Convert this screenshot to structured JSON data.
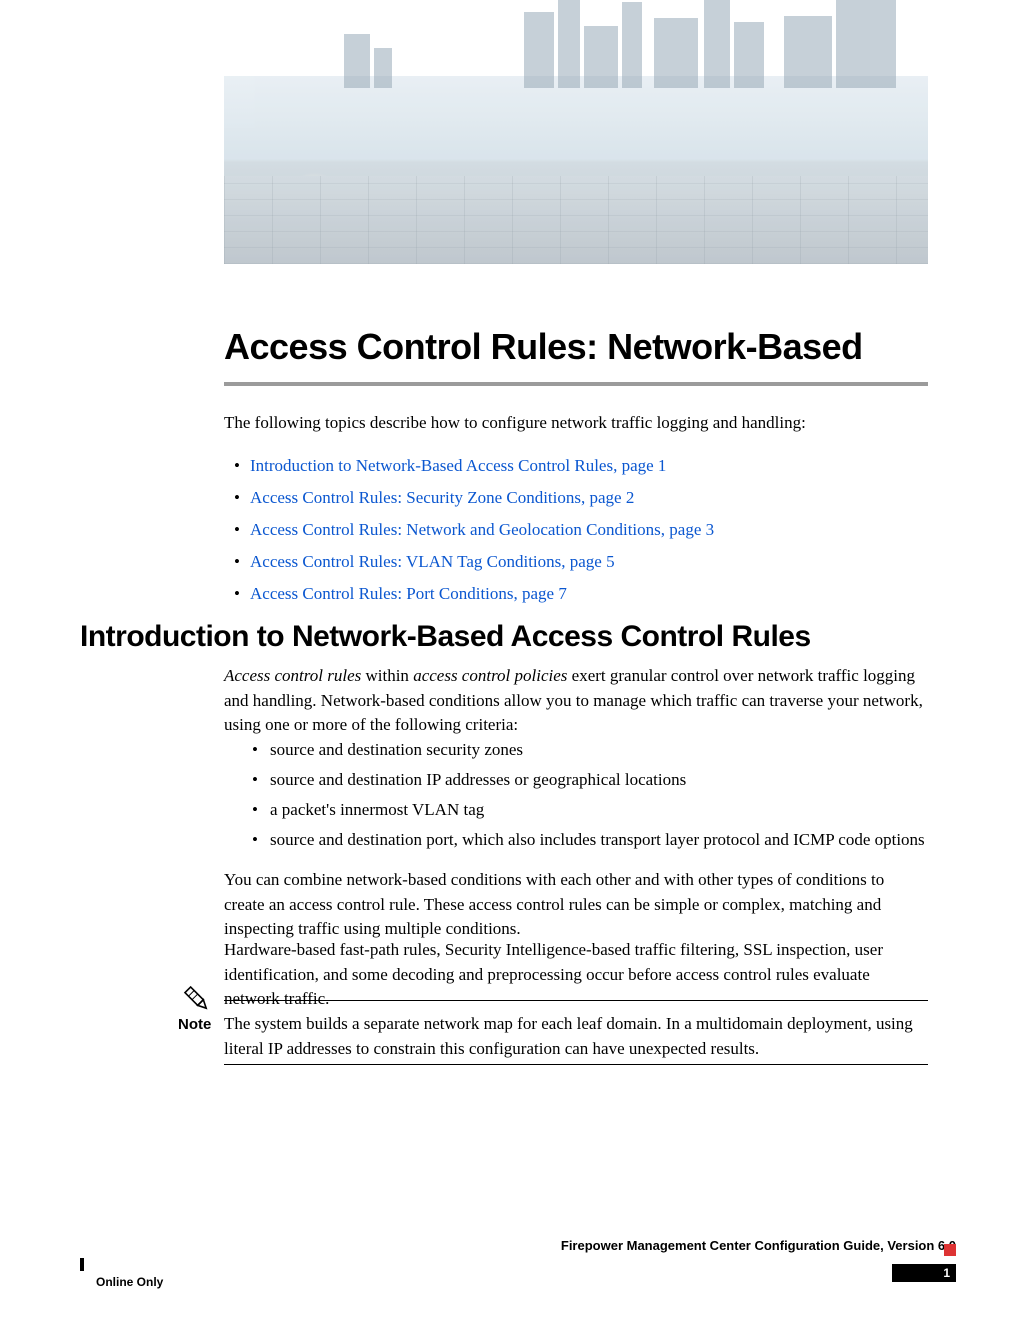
{
  "title": "Access Control Rules: Network-Based",
  "intro": "The following topics describe how to configure network traffic logging and handling:",
  "toc": [
    "Introduction to Network-Based Access Control Rules,  page  1",
    "Access Control Rules: Security Zone Conditions,  page  2",
    "Access Control Rules: Network and Geolocation Conditions,  page  3",
    "Access Control Rules: VLAN Tag Conditions,  page  5",
    "Access Control Rules: Port Conditions,  page  7"
  ],
  "h2": "Introduction to Network-Based Access Control Rules",
  "body1_pre_i1": "Access control rules",
  "body1_mid": " within ",
  "body1_i2": "access control policies",
  "body1_post": " exert granular control over network traffic logging and handling. Network-based conditions allow you to manage which traffic can traverse your network, using one or more of the following criteria:",
  "criteria": [
    "source and destination security zones",
    "source and destination IP addresses or geographical locations",
    "a packet's innermost VLAN tag",
    "source and destination port, which also includes transport layer protocol and ICMP code options"
  ],
  "body2": "You can combine network-based conditions with each other and with other types of conditions to create an access control rule. These access control rules can be simple or complex, matching and inspecting traffic using multiple conditions.",
  "body3": "Hardware-based fast-path rules, Security Intelligence-based traffic filtering, SSL inspection, user identification, and some decoding and preprocessing occur before access control rules evaluate network traffic.",
  "note_label": "Note",
  "note_body": "The system builds a separate network map for each leaf domain. In a multidomain deployment, using literal IP addresses to constrain this configuration can have unexpected results.",
  "footer_title": "Firepower Management Center Configuration Guide, Version 6.0",
  "footer_left": "Online Only",
  "page_number": "1"
}
